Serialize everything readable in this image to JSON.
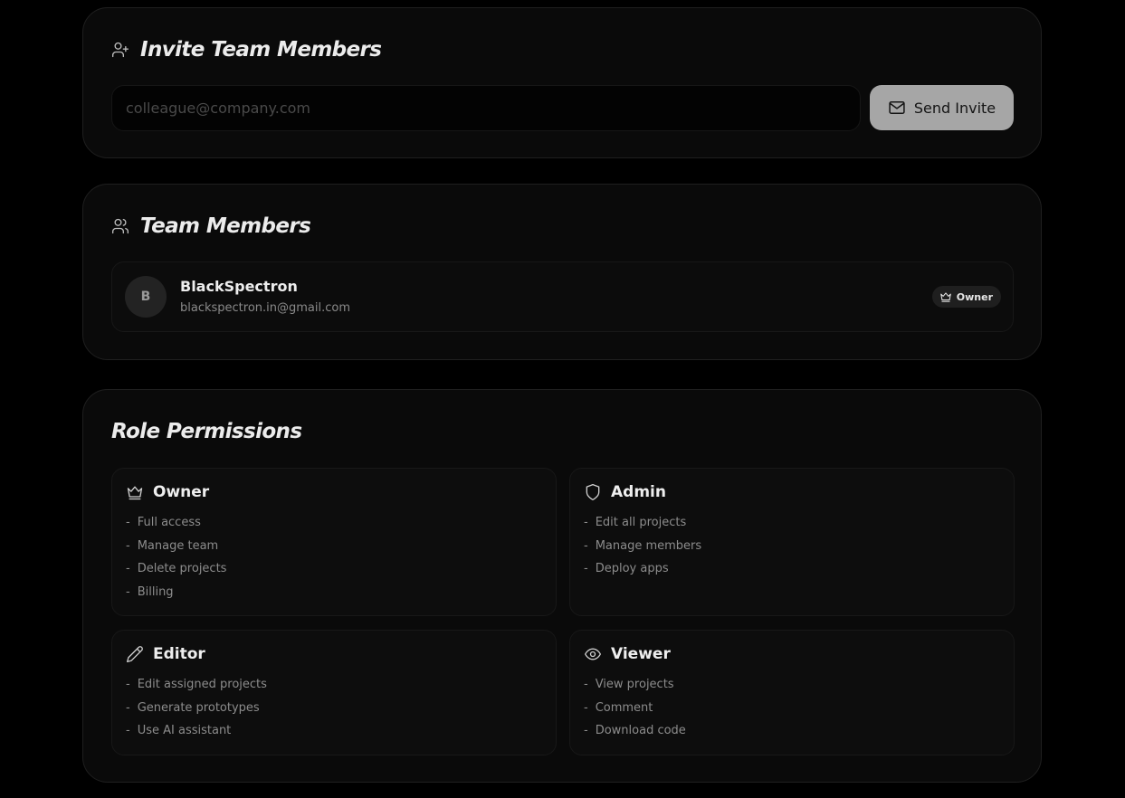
{
  "invite": {
    "title": "Invite Team Members",
    "icon": "user-plus-icon",
    "email_placeholder": "colleague@company.com",
    "email_value": "",
    "send_label": "Send Invite",
    "send_icon": "mail-icon"
  },
  "members": {
    "title": "Team Members",
    "icon": "users-icon",
    "list": [
      {
        "avatar_initial": "B",
        "name": "BlackSpectron",
        "email": "blackspectron.in@gmail.com",
        "role_badge": "Owner",
        "role_icon": "crown-icon"
      }
    ]
  },
  "roles": {
    "title": "Role Permissions",
    "items": [
      {
        "name": "Owner",
        "icon": "crown-icon",
        "permissions": [
          "Full access",
          "Manage team",
          "Delete projects",
          "Billing"
        ]
      },
      {
        "name": "Admin",
        "icon": "shield-icon",
        "permissions": [
          "Edit all projects",
          "Manage members",
          "Deploy apps"
        ]
      },
      {
        "name": "Editor",
        "icon": "pencil-icon",
        "permissions": [
          "Edit assigned projects",
          "Generate prototypes",
          "Use AI assistant"
        ]
      },
      {
        "name": "Viewer",
        "icon": "eye-icon",
        "permissions": [
          "View projects",
          "Comment",
          "Download code"
        ]
      }
    ]
  },
  "colors": {
    "background": "#000000",
    "card": "#0a0a0a",
    "button": "#a6a6a6",
    "text_primary": "#ededed",
    "text_muted": "#8a8a8a"
  }
}
